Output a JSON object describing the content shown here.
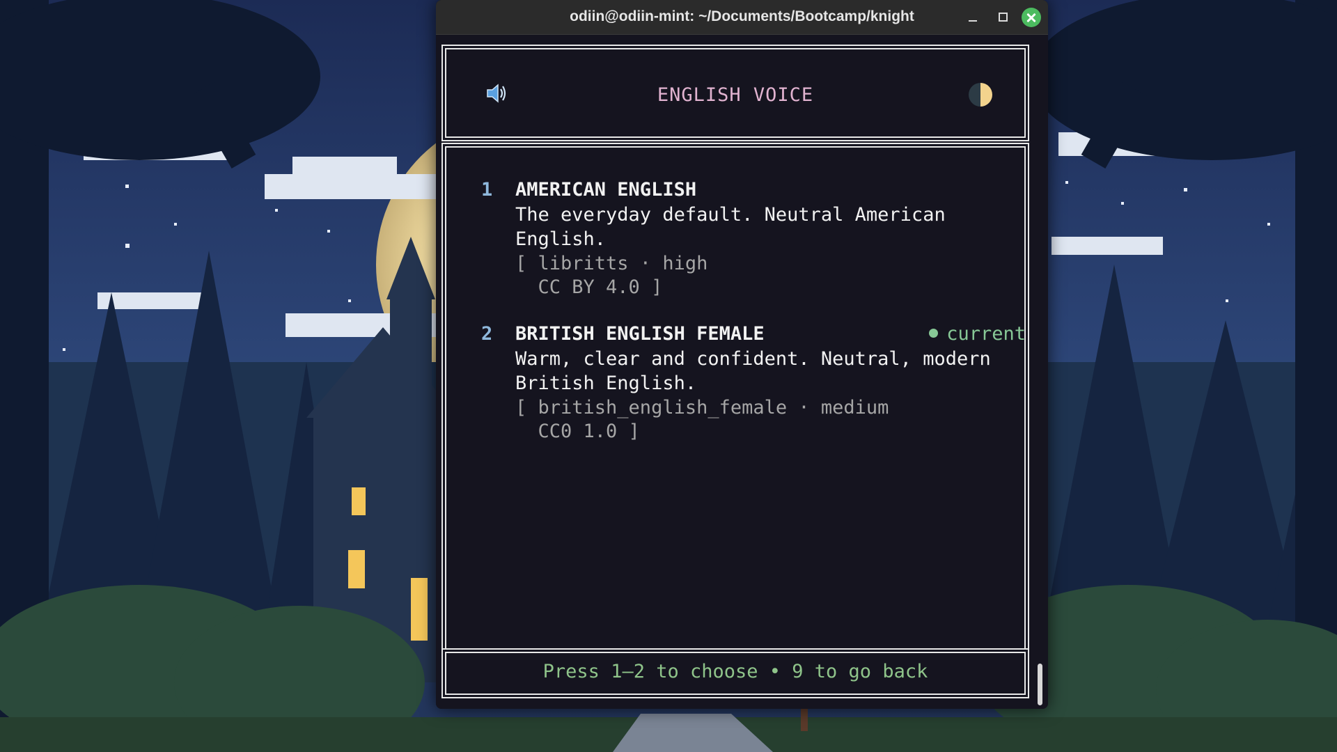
{
  "window": {
    "title": "odiin@odiin-mint: ~/Documents/Bootcamp/knight"
  },
  "header": {
    "title": "ENGLISH VOICE",
    "left_icon": "speaker-icon",
    "right_icon": "moon-icon"
  },
  "voices": [
    {
      "number": "1",
      "name": "AMERICAN ENGLISH",
      "description": "The everyday default. Neutral American English.",
      "meta_line1": "[ libritts · high",
      "meta_line2": "  CC BY 4.0 ]",
      "current": ""
    },
    {
      "number": "2",
      "name": "BRITISH ENGLISH FEMALE",
      "description": "Warm, clear and confident. Neutral, modern British English.",
      "meta_line1": "[ british_english_female · medium",
      "meta_line2": "  CC0 1.0 ]",
      "current": "current"
    }
  ],
  "footer": {
    "hint": "Press 1–2 to choose • 9 to go back"
  },
  "colors": {
    "title_accent": "#e1b3d0",
    "number": "#8fb8dc",
    "meta": "#a6a6a6",
    "current": "#87c896",
    "footer": "#8fc48a",
    "terminal_bg": "#15141f",
    "close_button": "#4cbb5f"
  }
}
